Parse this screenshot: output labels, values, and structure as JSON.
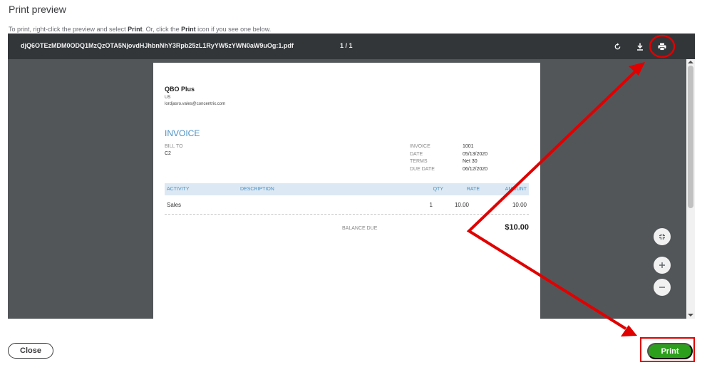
{
  "dialog": {
    "title": "Print preview",
    "instructions": {
      "part1": "To print, right-click the preview and select ",
      "bold1": "Print",
      "part2": ". Or, click the ",
      "bold2": "Print",
      "part3": " icon if you see one below."
    }
  },
  "viewer": {
    "filename": "djQ6OTEzMDM0ODQ1MzQzOTA5NjovdHJhbnNhY3Rpb25zL1RyYW5zYWN0aW9uOg:1.pdf",
    "page_count": "1 / 1",
    "toolbar_icons": [
      "rotate-icon",
      "download-icon",
      "print-icon"
    ],
    "side_icons": [
      "fit-page-icon",
      "zoom-in-icon",
      "zoom-out-icon"
    ]
  },
  "invoice": {
    "company": "QBO Plus",
    "country": "US",
    "email": "lordjasro.vales@concentrix.com",
    "heading": "INVOICE",
    "bill_to_label": "BILL TO",
    "bill_to_value": "C2",
    "meta_labels": [
      "INVOICE",
      "DATE",
      "TERMS",
      "DUE DATE"
    ],
    "meta_values": [
      "1001",
      "05/13/2020",
      "Net 30",
      "06/12/2020"
    ],
    "columns": [
      "ACTIVITY",
      "DESCRIPTION",
      "QTY",
      "RATE",
      "AMOUNT"
    ],
    "rows": [
      {
        "activity": "Sales",
        "description": "",
        "qty": "1",
        "rate": "10.00",
        "amount": "10.00"
      }
    ],
    "balance_label": "BALANCE DUE",
    "balance_value": "$10.00"
  },
  "actions": {
    "close_label": "Close",
    "print_label": "Print"
  },
  "colors": {
    "accent_blue": "#4a90c2",
    "header_bg": "#dce9f4",
    "print_green": "#2ca01c",
    "annotation_red": "#e00000",
    "viewer_bg": "#525659",
    "viewer_toolbar": "#323639"
  }
}
